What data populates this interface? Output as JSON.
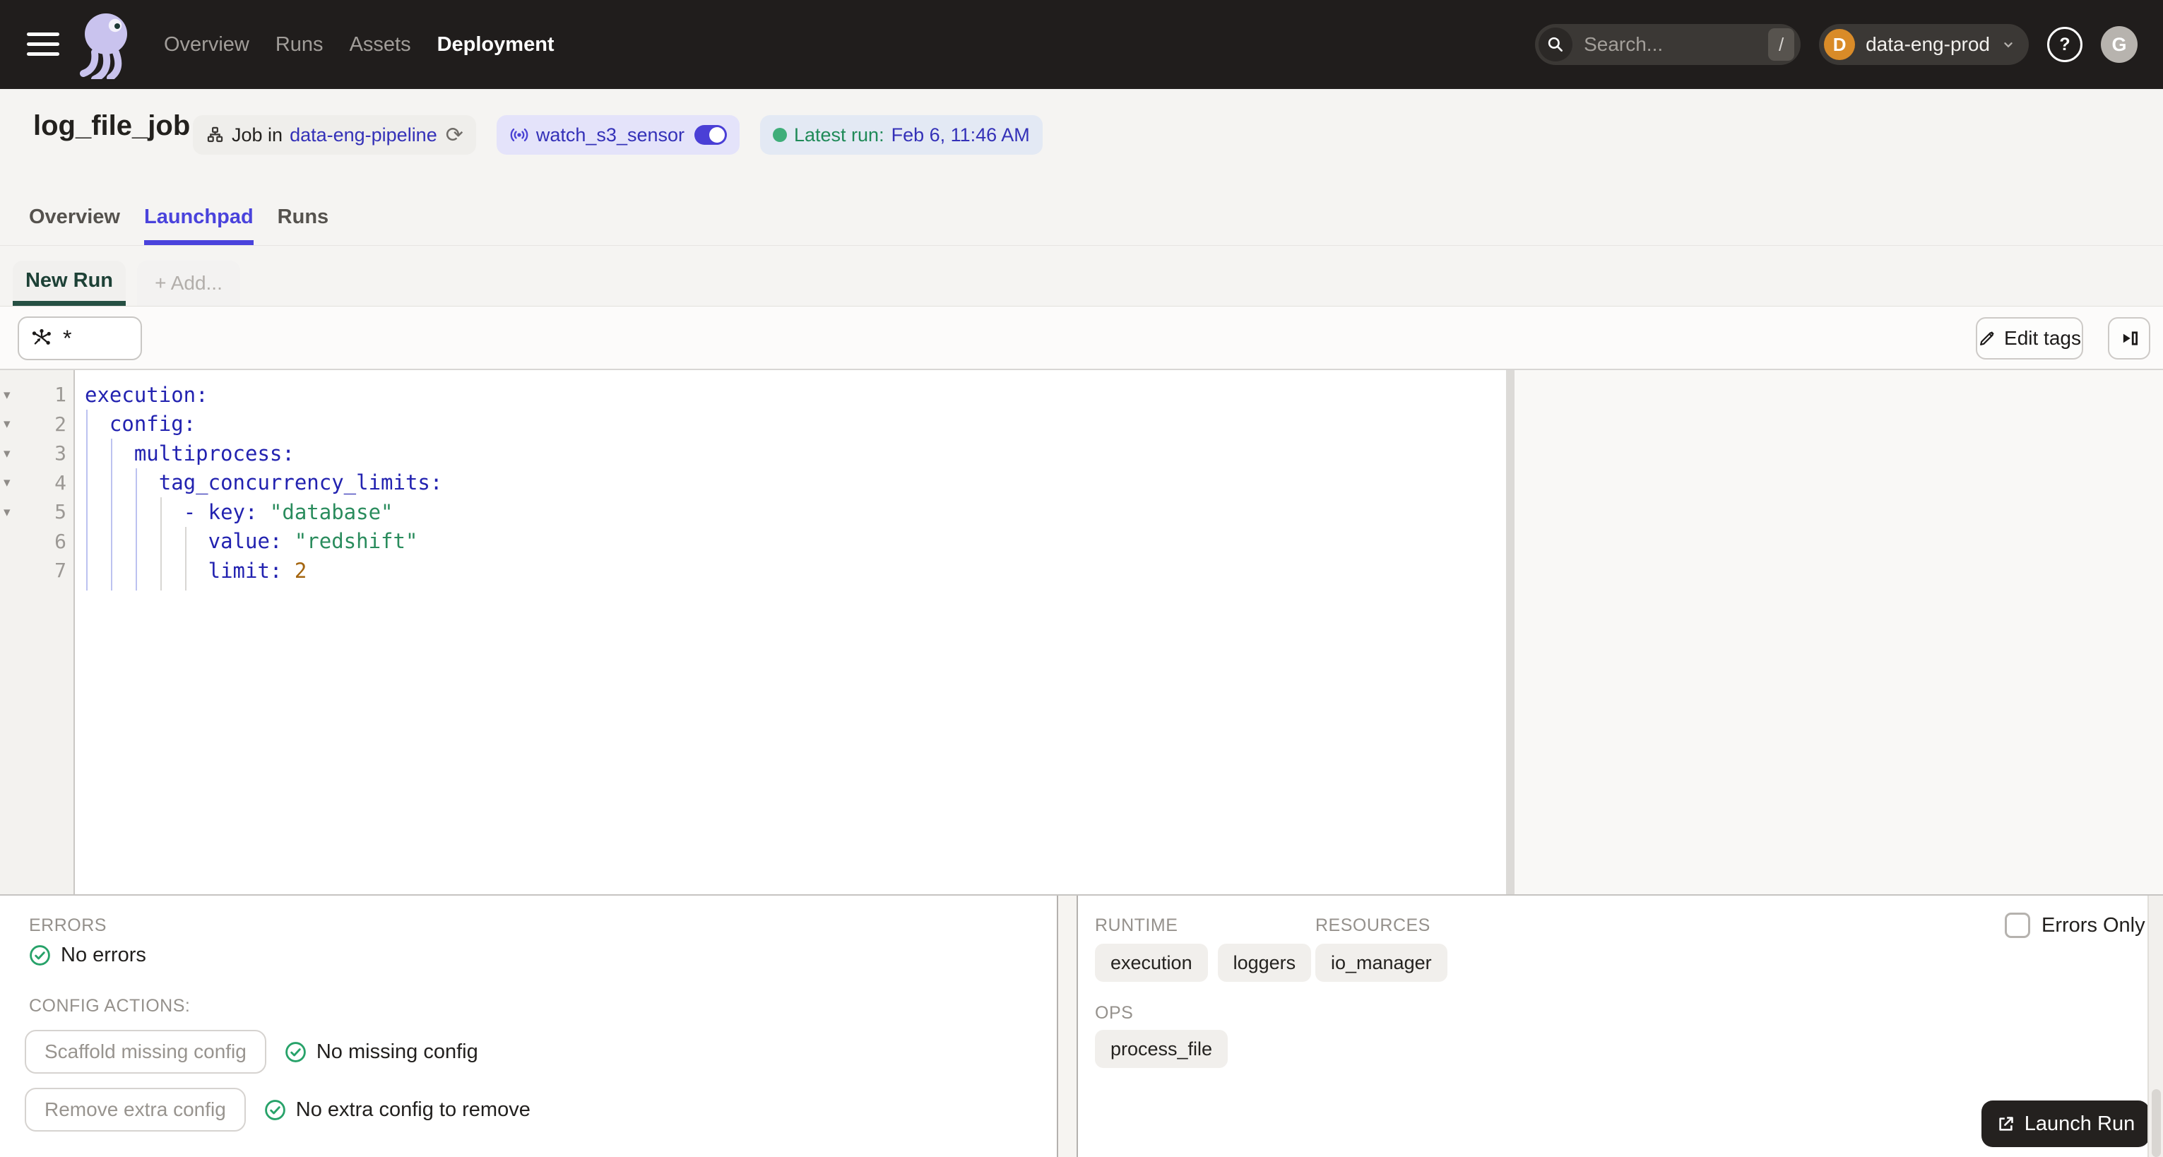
{
  "topnav": {
    "nav_items": [
      {
        "label": "Overview",
        "active": false
      },
      {
        "label": "Runs",
        "active": false
      },
      {
        "label": "Assets",
        "active": false
      },
      {
        "label": "Deployment",
        "active": true
      }
    ],
    "search": {
      "placeholder": "Search...",
      "shortcut": "/"
    },
    "workspace": {
      "initial": "D",
      "name": "data-eng-prod"
    },
    "user_initial": "G"
  },
  "job_header": {
    "title": "log_file_job",
    "job_badge": {
      "prefix": "Job in",
      "repo_link": "data-eng-pipeline"
    },
    "sensor_badge": {
      "name": "watch_s3_sensor",
      "enabled": true
    },
    "latest_run_badge": {
      "label": "Latest run:",
      "value": "Feb 6, 11:46 AM"
    }
  },
  "page_tabs": [
    {
      "label": "Overview",
      "active": false
    },
    {
      "label": "Launchpad",
      "active": true
    },
    {
      "label": "Runs",
      "active": false
    }
  ],
  "launchpad": {
    "run_tabs": [
      {
        "label": "New Run",
        "active": true
      },
      {
        "label": "+ Add...",
        "active": false
      }
    ],
    "op_selector": {
      "value": "*"
    },
    "toolbar": {
      "edit_tags": "Edit tags"
    },
    "editor": {
      "language": "yaml",
      "lines": [
        {
          "num": "1",
          "tokens": [
            [
              "key",
              "execution"
            ],
            [
              "punc",
              ":"
            ]
          ]
        },
        {
          "num": "2",
          "tokens": [
            [
              "ws",
              "  "
            ],
            [
              "key",
              "config"
            ],
            [
              "punc",
              ":"
            ]
          ]
        },
        {
          "num": "3",
          "tokens": [
            [
              "ws",
              "    "
            ],
            [
              "key",
              "multiprocess"
            ],
            [
              "punc",
              ":"
            ]
          ]
        },
        {
          "num": "4",
          "tokens": [
            [
              "ws",
              "      "
            ],
            [
              "key",
              "tag_concurrency_limits"
            ],
            [
              "punc",
              ":"
            ]
          ]
        },
        {
          "num": "5",
          "tokens": [
            [
              "ws",
              "        "
            ],
            [
              "punc",
              "- "
            ],
            [
              "key",
              "key"
            ],
            [
              "punc",
              ": "
            ],
            [
              "str",
              "\"database\""
            ]
          ]
        },
        {
          "num": "6",
          "tokens": [
            [
              "ws",
              "          "
            ],
            [
              "key",
              "value"
            ],
            [
              "punc",
              ": "
            ],
            [
              "str",
              "\"redshift\""
            ]
          ]
        },
        {
          "num": "7",
          "tokens": [
            [
              "ws",
              "          "
            ],
            [
              "key",
              "limit"
            ],
            [
              "punc",
              ": "
            ],
            [
              "num",
              "2"
            ]
          ]
        }
      ]
    }
  },
  "bottom_panel": {
    "errors_label": "ERRORS",
    "no_errors": "No errors",
    "config_actions_label": "CONFIG ACTIONS:",
    "actions": [
      {
        "button": "Scaffold missing config",
        "status": "No missing config"
      },
      {
        "button": "Remove extra config",
        "status": "No extra config to remove"
      }
    ],
    "runtime_label": "RUNTIME",
    "runtime_tags": [
      "execution",
      "loggers"
    ],
    "resources_label": "RESOURCES",
    "resource_tags": [
      "io_manager"
    ],
    "ops_label": "OPS",
    "op_tags": [
      "process_file"
    ],
    "errors_only_label": "Errors Only",
    "errors_only_checked": false,
    "launch_button": "Launch Run"
  },
  "icons": {
    "hamburger-icon": "three horizontal bars",
    "dagster-logo": "octopus mascot",
    "search-icon": "magnifier",
    "chevron-down-icon": "⌄",
    "help-icon": "? in circle",
    "job-graph-icon": "org-chart boxes",
    "refresh-icon": "⟳",
    "sensor-icon": "((•)) radio waves",
    "toggle-on-icon": "switch on",
    "status-dot-icon": "●",
    "op-selector-icon": "asterisk node graph with arrow",
    "edit-pencil-icon": "✎",
    "expand-panel-icon": "▶▯",
    "fold-arrow-icon": "▾",
    "check-circle-icon": "✓ in circle",
    "launch-icon": "open-in-new arrow",
    "checkbox-icon": "☐ unchecked"
  },
  "colors": {
    "topnav_bg": "#201d1c",
    "accent_indigo": "#4a43dc",
    "link_indigo": "#3431b8",
    "status_green": "#1f8a58",
    "green_dot": "#3fae79",
    "new_run_green": "#1d4136",
    "sensor_badge_bg": "#e4e3fa",
    "latest_badge_bg": "#e3e9f4",
    "workspace_avatar_bg": "#d98b28",
    "launch_button_bg": "#24211f",
    "code_key": "#2222b0",
    "code_string": "#2a8c5d",
    "code_number": "#a4650f"
  }
}
